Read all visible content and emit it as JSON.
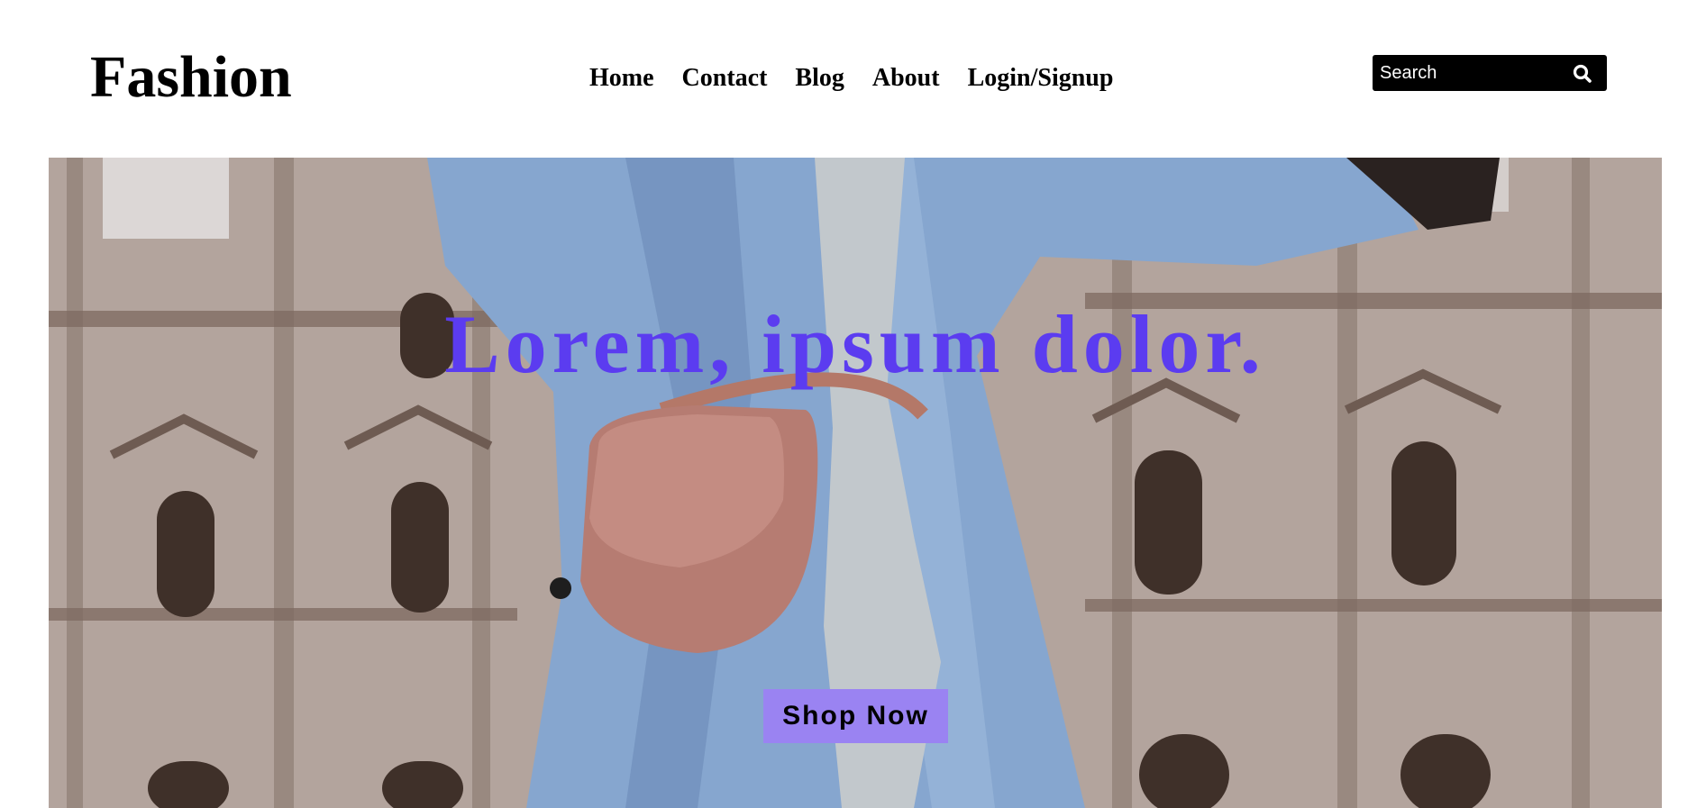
{
  "header": {
    "logo": "Fashion",
    "nav": [
      {
        "label": "Home"
      },
      {
        "label": "Contact"
      },
      {
        "label": "Blog"
      },
      {
        "label": "About"
      },
      {
        "label": "Login/Signup"
      }
    ],
    "search": {
      "placeholder": "Search",
      "value": "",
      "icon": "search-icon"
    }
  },
  "hero": {
    "title": "Lorem, ipsum dolor.",
    "button_label": "Shop Now",
    "image_description_icon": "fashion-photo"
  },
  "colors": {
    "title_color": "#5b3cf0",
    "button_bg": "#9a83f2",
    "search_bg": "#000000"
  }
}
